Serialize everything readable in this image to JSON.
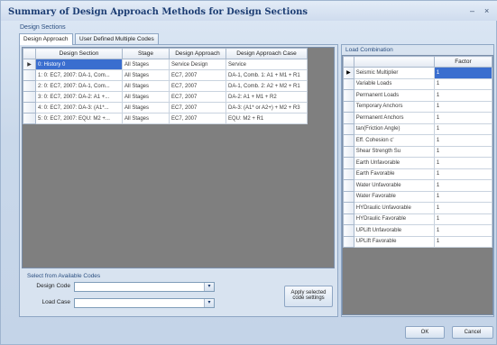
{
  "window": {
    "title": "Summary of Design Approach Methods for Design Sections",
    "minimize_glyph": "–",
    "close_glyph": "×"
  },
  "design_sections_label": "Design Sections",
  "tabs": [
    {
      "label": "Design Approach",
      "active": true
    },
    {
      "label": "User Defined Multiple Codes",
      "active": false
    }
  ],
  "grid": {
    "columns": [
      "Design Section",
      "Stage",
      "Design Approach",
      "Design Approach Case"
    ],
    "rows": [
      {
        "indicator": "▶",
        "section": "0: History 0",
        "stage": "All Stages",
        "approach": "Service Design",
        "case": "Service"
      },
      {
        "indicator": "",
        "section": "1: 0: EC7, 2007: DA-1, Com...",
        "stage": "All Stages",
        "approach": "EC7, 2007",
        "case": "DA-1, Comb. 1: A1 + M1 + R1"
      },
      {
        "indicator": "",
        "section": "2: 0: EC7, 2007: DA-1, Com...",
        "stage": "All Stages",
        "approach": "EC7, 2007",
        "case": "DA-1, Comb. 2: A2 + M2 + R1"
      },
      {
        "indicator": "",
        "section": "3: 0: EC7, 2007: DA-2: A1 +...",
        "stage": "All Stages",
        "approach": "EC7, 2007",
        "case": "DA-2: A1 + M1 + R2"
      },
      {
        "indicator": "",
        "section": "4: 0: EC7, 2007: DA-3: (A1*...",
        "stage": "All Stages",
        "approach": "EC7, 2007",
        "case": "DA-3: (A1* or A2+) + M2 + R3"
      },
      {
        "indicator": "",
        "section": "5: 0: EC7, 2007: EQU: M2 +...",
        "stage": "All Stages",
        "approach": "EC7, 2007",
        "case": "EQU: M2 + R1"
      }
    ]
  },
  "codes": {
    "group_label": "Select from Available Codes",
    "design_code_label": "Design Code",
    "design_code_value": "",
    "load_case_label": "Load Case",
    "load_case_value": "",
    "dropdown_glyph": "▾",
    "apply_label_line1": "Apply selected",
    "apply_label_line2": "code settings"
  },
  "load_combination": {
    "label": "Load Combination",
    "factor_header": "Factor",
    "rows": [
      {
        "indicator": "▶",
        "name": "Seismic Multiplier",
        "factor": "1"
      },
      {
        "indicator": "",
        "name": "Variable Loads",
        "factor": "1"
      },
      {
        "indicator": "",
        "name": "Permanent Loads",
        "factor": "1"
      },
      {
        "indicator": "",
        "name": "Temporary Anchors",
        "factor": "1"
      },
      {
        "indicator": "",
        "name": "Permanent Anchors",
        "factor": "1"
      },
      {
        "indicator": "",
        "name": "tan(Friction Angle)",
        "factor": "1"
      },
      {
        "indicator": "",
        "name": "Eff. Cohesion c'",
        "factor": "1"
      },
      {
        "indicator": "",
        "name": "Shear Strength Su",
        "factor": "1"
      },
      {
        "indicator": "",
        "name": "Earth Unfavorable",
        "factor": "1"
      },
      {
        "indicator": "",
        "name": "Earth Favorable",
        "factor": "1"
      },
      {
        "indicator": "",
        "name": "Water Unfavorable",
        "factor": "1"
      },
      {
        "indicator": "",
        "name": "Water Favorable",
        "factor": "1"
      },
      {
        "indicator": "",
        "name": "HYDraulic Unfavorable",
        "factor": "1"
      },
      {
        "indicator": "",
        "name": "HYDraulic Favorable",
        "factor": "1"
      },
      {
        "indicator": "",
        "name": "UPLift Unfavorable",
        "factor": "1"
      },
      {
        "indicator": "",
        "name": "UPLift Favorable",
        "factor": "1"
      }
    ]
  },
  "footer": {
    "ok_label": "OK",
    "cancel_label": "Cancel"
  }
}
